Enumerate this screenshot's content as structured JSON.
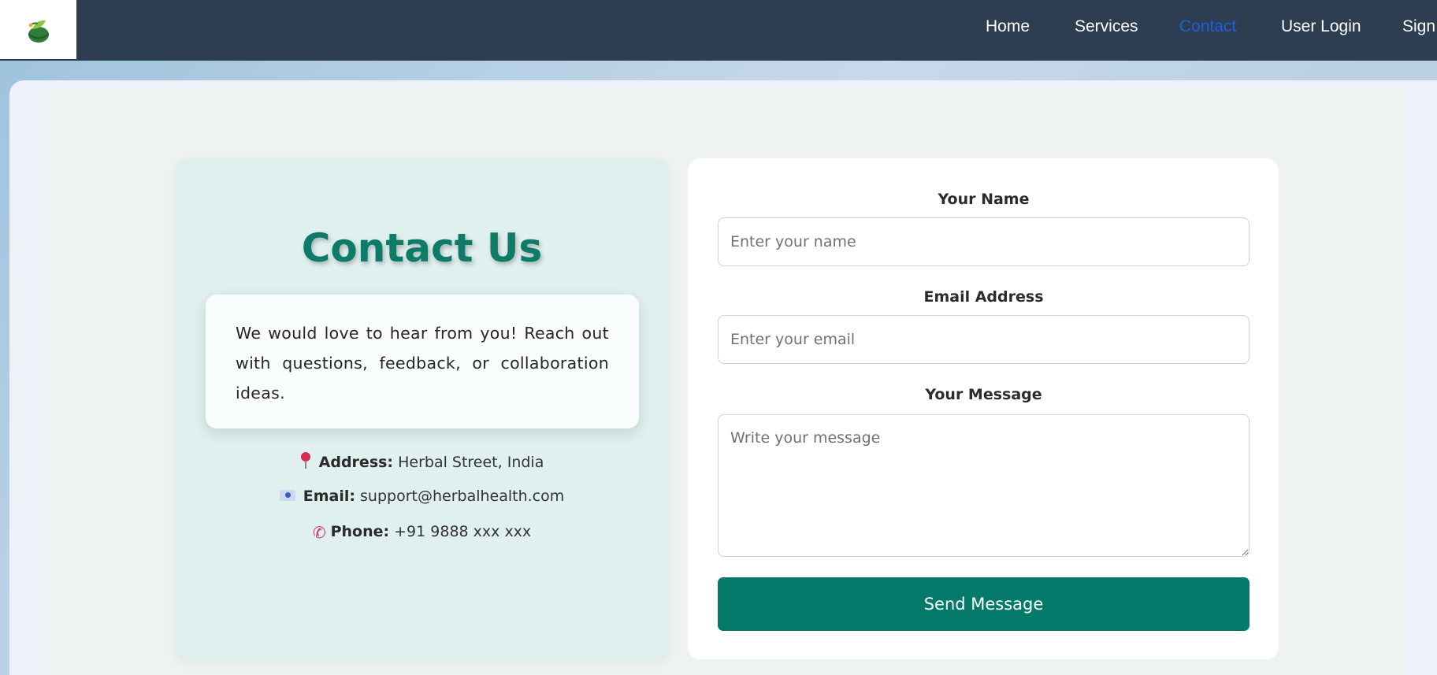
{
  "nav": {
    "logo_icon": "herbal-mortar-leaf-logo",
    "items": [
      {
        "label": "Home"
      },
      {
        "label": "Services"
      },
      {
        "label": "Contact",
        "active": true
      },
      {
        "label": "User Login"
      },
      {
        "label": "Sign"
      }
    ]
  },
  "contact": {
    "title": "Contact Us",
    "intro": "We would love to hear from you! Reach out with questions, feedback, or collaboration ideas.",
    "address_label": "Address:",
    "address_value": "Herbal Street, India",
    "email_label": "Email:",
    "email_value": "support@herbalhealth.com",
    "phone_label": "Phone:",
    "phone_value": "+91 9888 xxx xxx"
  },
  "form": {
    "name_label": "Your Name",
    "name_placeholder": "Enter your name",
    "email_label": "Email Address",
    "email_placeholder": "Enter your email",
    "message_label": "Your Message",
    "message_placeholder": "Write your message",
    "submit_label": "Send Message"
  },
  "colors": {
    "navbar": "#2e3e52",
    "accent": "#05796a",
    "active_nav": "#1f5fd6"
  }
}
